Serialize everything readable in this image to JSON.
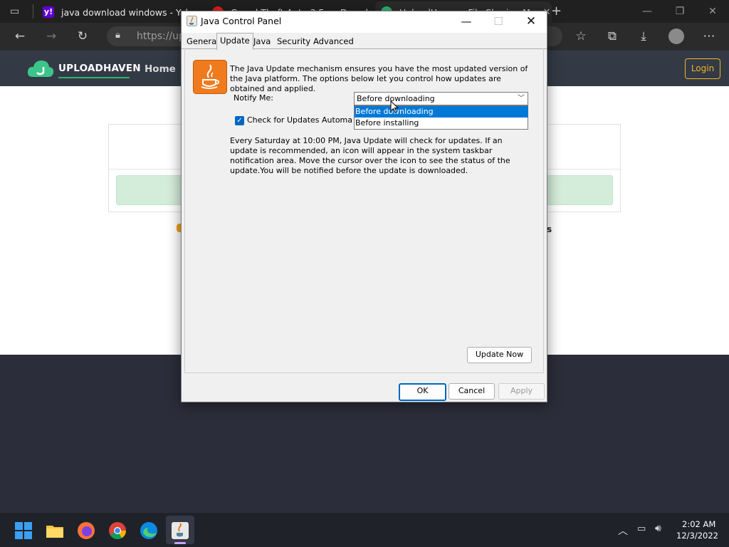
{
  "browser": {
    "tabs": [
      {
        "title": "java download windows - Yahoo",
        "icon": "yahoo-icon",
        "color": "#6001d2"
      },
      {
        "title": "Grand Theft Auto 3 Free Downl",
        "icon": "red-icon",
        "color": "#e0201b"
      },
      {
        "title": "UploadHaven - File Sharing Ma",
        "icon": "uploadhaven-icon",
        "color": "#2fb36f"
      }
    ],
    "address": "https://up"
  },
  "site": {
    "brand": "UPLOADHAVEN",
    "nav_home": "Home",
    "login": "Login",
    "fragment_right": "s"
  },
  "dialog": {
    "title": "Java Control Panel",
    "tabs": [
      "General",
      "Update",
      "Java",
      "Security",
      "Advanced"
    ],
    "selected_tab": "Update",
    "description": "The Java Update mechanism ensures you have the most updated version of the Java platform. The options below let you control how updates are obtained and applied.",
    "notify_label": "Notify Me:",
    "notify_value": "Before downloading",
    "notify_options": [
      "Before downloading",
      "Before installing"
    ],
    "check_label": "Check for Updates Automatically",
    "check_checked": true,
    "schedule_text": "Every Saturday at 10:00 PM, Java Update will check for updates. If an update is recommended, an icon will appear in the system taskbar notification area. Move the cursor over the icon to see the status of the update.You will be notified before the update is downloaded.",
    "update_now": "Update Now",
    "ok": "OK",
    "cancel": "Cancel",
    "apply": "Apply"
  },
  "taskbar": {
    "time": "2:02 AM",
    "date": "12/3/2022"
  }
}
